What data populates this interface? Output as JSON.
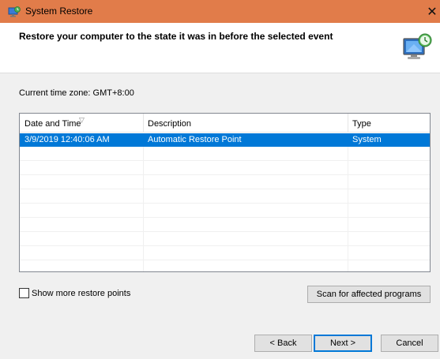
{
  "window": {
    "title": "System Restore",
    "close_glyph": "✕",
    "titlebar_color": "#e17c4a"
  },
  "header": {
    "title": "Restore your computer to the state it was in before the selected event"
  },
  "timezone": "Current time zone: GMT+8:00",
  "table": {
    "columns": [
      "Date and Time",
      "Description",
      "Type"
    ],
    "sort_indicator": "▽",
    "rows": [
      {
        "date": "3/9/2019 12:40:06 AM",
        "description": "Automatic Restore Point",
        "type": "System",
        "selected": true
      }
    ],
    "selection_color": "#0078d7"
  },
  "options": {
    "show_more_label": "Show more restore points",
    "show_more_checked": false
  },
  "buttons": {
    "scan": "Scan for affected programs",
    "back": "< Back",
    "next": "Next >",
    "cancel": "Cancel"
  }
}
